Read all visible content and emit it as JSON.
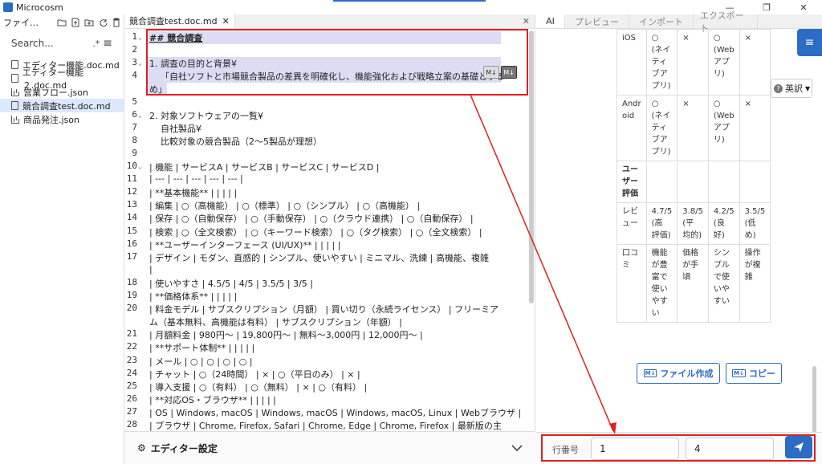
{
  "app": {
    "title": "Microcosm"
  },
  "colors": {
    "accent": "#2b6cc4",
    "highlight": "#dcdcf4",
    "annotation": "#e02020"
  },
  "window_controls": [
    "—",
    "❐",
    "✕"
  ],
  "sidebar": {
    "toolbar_label": "ファイ…",
    "search_placeholder": "Search...",
    "search_regex": ".*",
    "files": [
      {
        "name": "エディター機能.doc.md",
        "icon": "file-icon"
      },
      {
        "name": "エディター機能２.doc.md",
        "icon": "file-icon"
      },
      {
        "name": "営業フロー.json",
        "icon": "chart-icon"
      },
      {
        "name": "競合調査test.doc.md",
        "icon": "file-icon",
        "selected": true
      },
      {
        "name": "商品発注.json",
        "icon": "chart-icon"
      }
    ]
  },
  "editor": {
    "tab_label": "競合調査test.doc.md",
    "tab_close": "✕",
    "md_badge": "M↓",
    "lines": [
      {
        "n": "1",
        "fold": true,
        "text": "## 競合調査",
        "hl": true
      },
      {
        "n": "2",
        "text": ""
      },
      {
        "n": "3",
        "fold": true,
        "text": "1. 調査の目的と背景¥",
        "hl": true
      },
      {
        "n": "4",
        "text": "    「自社ソフトと市場競合製品の差異を明確化し、機能強化および戦略立案の基礎とする",
        "hl": true
      },
      {
        "n": "",
        "text": "め」",
        "hl": true
      },
      {
        "n": "5",
        "text": ""
      },
      {
        "n": "6",
        "fold": true,
        "text": "2. 対象ソフトウェアの一覧¥"
      },
      {
        "n": "7",
        "text": "    自社製品¥"
      },
      {
        "n": "8",
        "text": "    比較対象の競合製品（2〜5製品が理想）"
      },
      {
        "n": "9",
        "text": ""
      },
      {
        "n": "10",
        "fold": true,
        "text": "| 機能 | サービスA | サービスB | サービスC | サービスD |"
      },
      {
        "n": "11",
        "text": "| --- | --- | --- | --- | --- |"
      },
      {
        "n": "12",
        "text": "| **基本機能** | | | | |"
      },
      {
        "n": "13",
        "text": "| 編集 | ○（高機能） | ○（標準） | ○（シンプル） | ○（高機能） |"
      },
      {
        "n": "14",
        "text": "| 保存 | ○（自動保存） | ○（手動保存） | ○（クラウド連携） | ○（自動保存） |"
      },
      {
        "n": "15",
        "text": "| 検索 | ○（全文検索） | ○（キーワード検索） | ○（タグ検索） | ○（全文検索） |"
      },
      {
        "n": "16",
        "text": "| **ユーザーインターフェース (UI/UX)** | | | | |"
      },
      {
        "n": "17",
        "text": "| デザイン | モダン、直感的 | シンプル、使いやすい | ミニマル、洗練 | 高機能、複雑"
      },
      {
        "n": "",
        "text": "|"
      },
      {
        "n": "18",
        "text": "| 使いやすさ | 4.5/5 | 4/5 | 3.5/5 | 3/5 |"
      },
      {
        "n": "19",
        "text": "| **価格体系** | | | | |"
      },
      {
        "n": "20",
        "text": "| 料金モデル | サブスクリプション（月額） | 買い切り（永続ライセンス） | フリーミア"
      },
      {
        "n": "",
        "text": "ム（基本無料、高機能は有料） | サブスクリプション（年額） |"
      },
      {
        "n": "21",
        "text": "| 月額料金 | 980円〜 | 19,800円〜 | 無料〜3,000円 | 12,000円〜 |"
      },
      {
        "n": "22",
        "text": "| **サポート体制** | | | | |"
      },
      {
        "n": "23",
        "text": "| メール | ○ | ○ | ○ | ○ |"
      },
      {
        "n": "24",
        "text": "| チャット | ○（24時間） | × | ○（平日のみ） | × |"
      },
      {
        "n": "25",
        "text": "| 導入支援 | ○（有料） | ○（無料） | × | ○（有料） |"
      },
      {
        "n": "26",
        "text": "| **対応OS・ブラウザ** | | | | |"
      },
      {
        "n": "27",
        "text": "| OS | Windows, macOS | Windows, macOS | Windows, macOS, Linux | Webブラウザ |"
      },
      {
        "n": "28",
        "text": "| ブラウザ | Chrome, Firefox, Safari | Chrome, Edge | Chrome, Firefox | 最新版の主"
      },
      {
        "n": "",
        "text": "要ブラウザ |"
      }
    ],
    "settings_label": "エディター設定"
  },
  "right": {
    "tabs": [
      "AI",
      "プレビュー",
      "インポート",
      "エクスポート"
    ],
    "lang_label": "英訳",
    "preview_rows": [
      [
        "iOS",
        "○\n(ネイ\nティ\nブア\nプリ)",
        "×",
        "○\n(Web\nアプ\nリ)",
        "×"
      ],
      [
        "Andr\noid",
        "○\n(ネイ\nティ\nブア\nプリ)",
        "×",
        "○\n(Web\nアプ\nリ)",
        "×"
      ],
      [
        "ユー\nザー\n評価",
        "",
        "",
        "",
        ""
      ],
      [
        "レビ\nュー",
        "4.7/5\n(高\n評価)",
        "3.8/5\n(平\n均的)",
        "4.2/5\n(良\n好)",
        "3.5/5\n(低\nめ)"
      ],
      [
        "口コ\nミ",
        "機能\nが豊\n富で\n使い\nやす\nい",
        "価格\nが手\n頃",
        "シン\nプル\nで使\nいや\nすい",
        "操作\nが複\n雑"
      ]
    ],
    "create_file_label": "ファイル作成",
    "copy_label": "コピー",
    "md_badge": "M↓",
    "line_label": "行番号",
    "line_from": "1",
    "line_to": "4"
  }
}
